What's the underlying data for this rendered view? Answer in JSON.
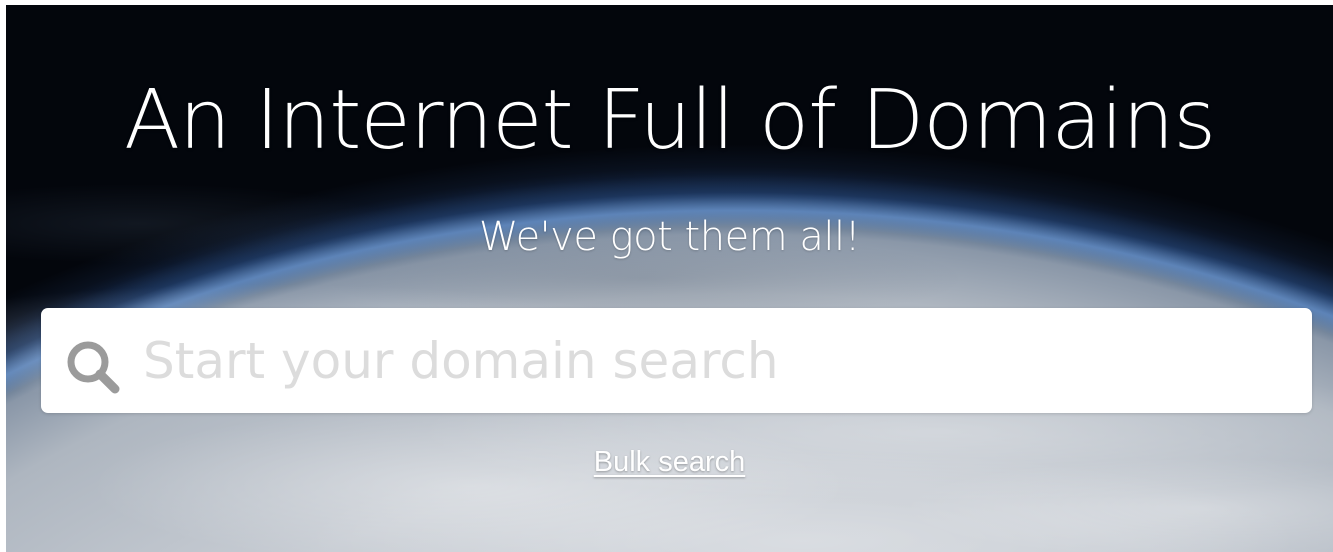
{
  "hero": {
    "title": "An Internet Full of Domains",
    "subtitle": "We've got them all!"
  },
  "search": {
    "icon": "search-icon",
    "placeholder": "Start your domain search",
    "value": ""
  },
  "bulk_search": {
    "label": "Bulk search"
  },
  "colors": {
    "text": "#ffffff",
    "search_bg": "#ffffff",
    "icon": "#9b9b9b",
    "placeholder": "#dcdcdc"
  }
}
